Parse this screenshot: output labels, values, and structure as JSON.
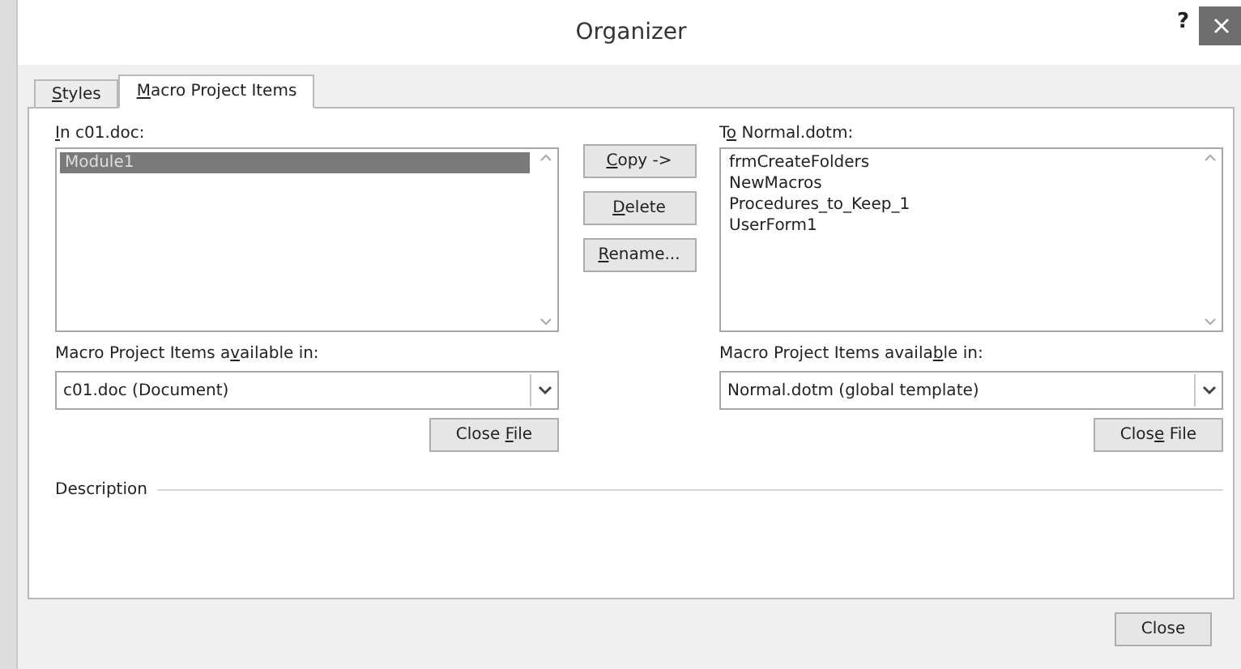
{
  "window": {
    "title": "Organizer",
    "help": "?"
  },
  "tabs": [
    {
      "key": "S",
      "post": "tyles",
      "selected": false
    },
    {
      "key": "M",
      "post": "acro Project Items",
      "selected": true
    }
  ],
  "left": {
    "label": {
      "key": "I",
      "post": "n c01.doc:"
    },
    "items": [
      {
        "text": "Module1",
        "selected": true
      }
    ],
    "available_label": {
      "pre": "Macro Project Items a",
      "key": "v",
      "post": "ailable in:"
    },
    "dropdown": "c01.doc (Document)",
    "close_file": {
      "pre": "Close ",
      "key": "F",
      "post": "ile"
    }
  },
  "actions": [
    {
      "key": "C",
      "post": "opy ->"
    },
    {
      "key": "D",
      "post": "elete"
    },
    {
      "key": "R",
      "post": "ename..."
    }
  ],
  "right": {
    "label": {
      "pre": "T",
      "key": "o",
      "post": " Normal.dotm:"
    },
    "items": [
      {
        "text": "frmCreateFolders",
        "selected": false
      },
      {
        "text": "NewMacros",
        "selected": false
      },
      {
        "text": "Procedures_to_Keep_1",
        "selected": false
      },
      {
        "text": "UserForm1",
        "selected": false
      }
    ],
    "available_label": {
      "pre": "Macro Project Items availa",
      "key": "b",
      "post": "le in:"
    },
    "dropdown": "Normal.dotm (global template)",
    "close_file": {
      "pre": "Clos",
      "key": "e",
      "post": " File"
    }
  },
  "description": {
    "label": "Description"
  },
  "close_button": "Close"
}
